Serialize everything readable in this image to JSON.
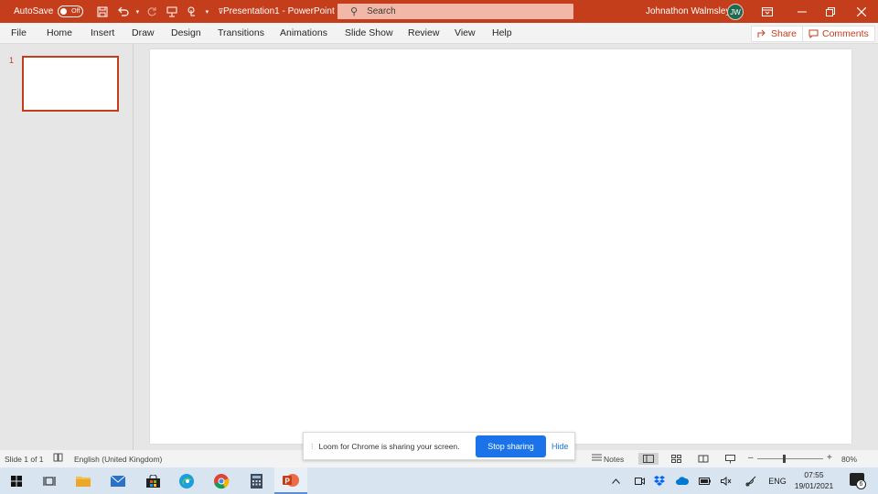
{
  "titlebar": {
    "autosave_label": "AutoSave",
    "autosave_state": "Off",
    "doc_title": "Presentation1  -  PowerPoint",
    "search_placeholder": "Search",
    "user_name": "Johnathon Walmsley",
    "user_initials": "JW"
  },
  "ribbon": {
    "tabs": [
      "File",
      "Home",
      "Insert",
      "Draw",
      "Design",
      "Transitions",
      "Animations",
      "Slide Show",
      "Review",
      "View",
      "Help"
    ],
    "share_label": "Share",
    "comments_label": "Comments"
  },
  "thumbnails": {
    "items": [
      {
        "number": "1"
      }
    ]
  },
  "statusbar": {
    "slide_info": "Slide 1 of 1",
    "language": "English (United Kingdom)",
    "notes_label": "Notes",
    "zoom_minus": "–",
    "zoom_plus": "+",
    "zoom_level": "80%",
    "zoom_fraction": 0.4
  },
  "loom": {
    "message": "Loom for Chrome is sharing your screen.",
    "stop_label": "Stop sharing",
    "hide_label": "Hide"
  },
  "taskbar": {
    "language": "ENG",
    "time": "07:55",
    "date": "19/01/2021",
    "notification_count": "6"
  },
  "colors": {
    "accent": "#c43e1c",
    "loom_blue": "#1a73e8"
  }
}
